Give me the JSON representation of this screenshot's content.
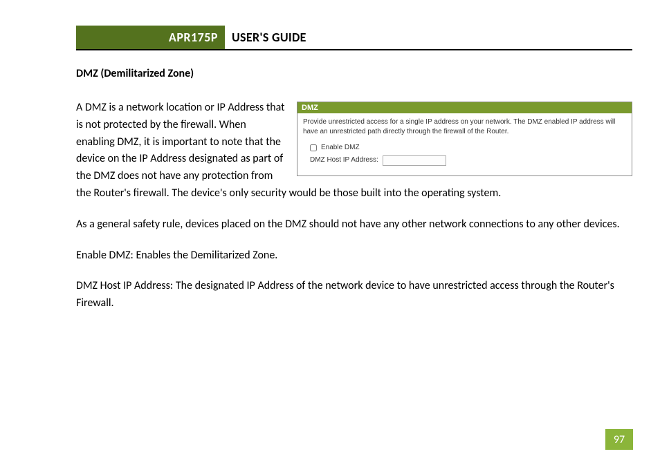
{
  "header": {
    "tag": "APR175P",
    "title": "USER'S GUIDE"
  },
  "section_heading": "DMZ (Demilitarized Zone)",
  "para_intro": "A DMZ is a network location or IP Address that is not protected by the firewall.  When enabling DMZ, it is important to note that the device on the IP Address designated as part of the DMZ does not have any protection from",
  "para_intro_cont": "the Router's firewall.  The device's only security would be those built into the operating system.",
  "para_safety": "As a general safety rule, devices placed on the DMZ should not have any other network connections to any other devices.",
  "para_enable": "Enable DMZ: Enables the Demilitarized Zone.",
  "para_hostip": "DMZ Host IP Address:  The designated IP Address of the network device to have unrestricted access through the Router's Firewall.",
  "inset": {
    "band": "DMZ",
    "desc": "Provide unrestricted access for a single IP address on your network. The DMZ enabled IP address will have an unrestricted path directly through the firewall of the Router.",
    "enable_label": "Enable DMZ",
    "ip_label": "DMZ Host IP Address:"
  },
  "page_number": "97"
}
